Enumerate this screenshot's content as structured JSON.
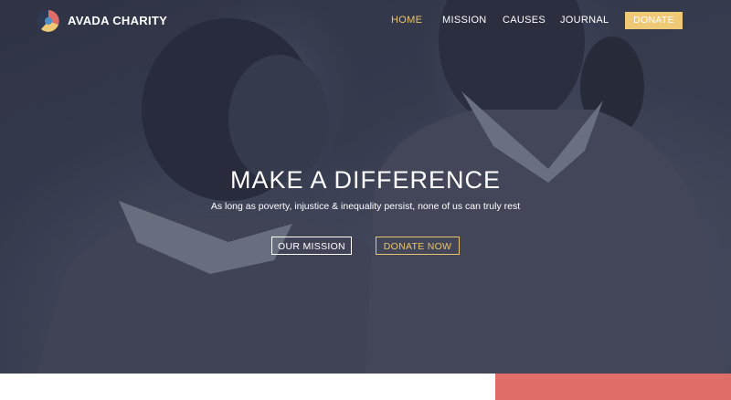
{
  "brand": {
    "name": "AVADA CHARITY",
    "icon": "avada-logo-icon"
  },
  "nav": {
    "items": [
      {
        "label": "HOME",
        "active": true
      },
      {
        "label": "MISSION",
        "active": false
      },
      {
        "label": "CAUSES",
        "active": false
      },
      {
        "label": "JOURNAL",
        "active": false
      }
    ],
    "donate_label": "DONATE"
  },
  "hero": {
    "title": "MAKE A DIFFERENCE",
    "subtitle": "As long as poverty, injustice & inequality persist, none of us can truly rest",
    "buttons": {
      "mission_label": "OUR MISSION",
      "donate_label": "DONATE NOW"
    }
  },
  "colors": {
    "accent_gold": "#e8c46f",
    "donate_bg": "#f0c977",
    "coral": "#e06d68",
    "hero_overlay": "#3a3e52"
  }
}
